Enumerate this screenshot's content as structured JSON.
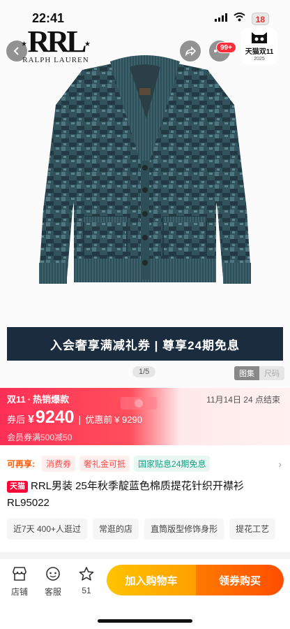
{
  "status": {
    "time": "22:41",
    "battery": "18"
  },
  "brand": {
    "logo_text": "RRL",
    "sub_text": "RALPH LAUREN"
  },
  "header": {
    "cart_badge": "99+",
    "tmall_title": "天猫双11",
    "tmall_year": "2025"
  },
  "gallery": {
    "promo_banner": "入会奢享满减礼券 | 尊享24期免息",
    "page_indicator": "1/5",
    "view_tabs": [
      "图集",
      "尺码"
    ]
  },
  "price": {
    "event": "双11",
    "event_tag": "热销爆款",
    "countdown": "11月14日 24 点结束",
    "after_coupon_label": "券后",
    "currency": "¥",
    "after_coupon_value": "9240",
    "separator": "|",
    "original_label": "优惠前",
    "original_value": "¥ 9290",
    "coupon_line": "会员券满500减50"
  },
  "perks": {
    "label": "可再享:",
    "items": [
      "消费券",
      "奢礼金可抵",
      "国家贴息24期免息"
    ]
  },
  "product": {
    "store_tag": "天猫",
    "title": "RRL男装 25年秋季靛蓝色棉质提花针织开襟衫RL95022"
  },
  "features": [
    "近7天 400+人逛过",
    "常逛的店",
    "直筒版型修饰身形",
    "提花工艺"
  ],
  "bottom_bar": {
    "nav": [
      {
        "label": "店铺",
        "icon": "store-icon"
      },
      {
        "label": "客服",
        "icon": "customer-service-icon"
      },
      {
        "label": "51",
        "icon": "star-icon"
      }
    ],
    "cart_button": "加入购物车",
    "buy_button": "领券购买"
  },
  "colors": {
    "price_red": "#ff2f55",
    "cart_yellow": "#ffb000",
    "buy_orange": "#ff6200",
    "banner_navy": "#1c2c3f"
  }
}
